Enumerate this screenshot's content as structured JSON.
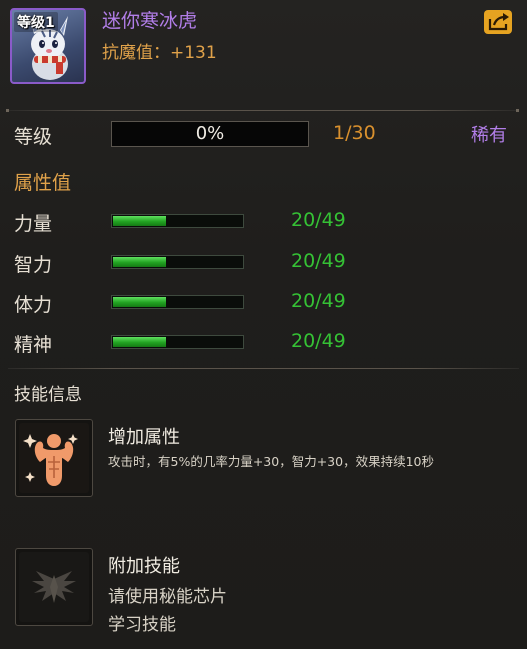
{
  "header": {
    "level_tag": "等级1",
    "pet_name": "迷你寒冰虎",
    "pet_stat": "抗魔值：+131",
    "share_icon": "share-export-icon"
  },
  "level": {
    "label": "等级",
    "progress_text": "0%",
    "progress": 0,
    "count": "1/30",
    "rarity": "稀有"
  },
  "attributes": {
    "title": "属性值",
    "items": [
      {
        "label": "力量",
        "value": "20/49",
        "fraction": 0.41
      },
      {
        "label": "智力",
        "value": "20/49",
        "fraction": 0.41
      },
      {
        "label": "体力",
        "value": "20/49",
        "fraction": 0.41
      },
      {
        "label": "精神",
        "value": "20/49",
        "fraction": 0.41
      }
    ]
  },
  "skills": {
    "title": "技能信息",
    "items": [
      {
        "name": "增加属性",
        "icon": "muscle-flex-icon",
        "description": "攻击时，有5%的几率力量+30，智力+30，效果持续10秒"
      },
      {
        "name": "附加技能",
        "icon": "locked-wing-emblem-icon",
        "line1": "请使用秘能芯片",
        "line2": "学习技能"
      }
    ]
  },
  "colors": {
    "rarity_purple": "#b27ee8",
    "gold": "#e0a24a",
    "bar_green": "#35c235",
    "count_orange": "#d9902e"
  }
}
